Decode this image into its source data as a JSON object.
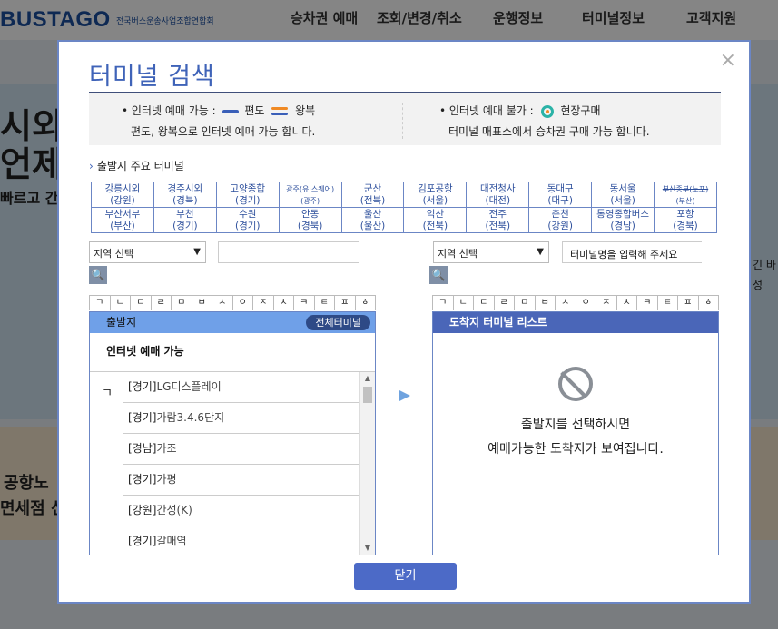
{
  "background": {
    "logo": "BUSTAGO",
    "logo_sub": "전국버스운송사업조합연합회",
    "nav": [
      "승차권 예매",
      "조회/변경/취소",
      "운행정보",
      "터미널정보",
      "고객지원"
    ],
    "banner_left": [
      "시외",
      "언제",
      "빠르고 간"
    ],
    "banner_right": [
      "긴 바",
      "성"
    ],
    "promo_left": [
      "공항노",
      "면세점 선"
    ]
  },
  "modal": {
    "title": "터미널 검색",
    "close_icon": "×",
    "info": {
      "possible_label": "• 인터넷 예매 가능 :",
      "oneway": "편도",
      "roundtrip": "왕복",
      "possible_desc": "편도, 왕복으로 인터넷 예매 가능 합니다.",
      "impossible_label": "• 인터넷 예매 불가 :",
      "onsite": "현장구매",
      "impossible_desc": "터미널 매표소에서 승차권 구매 가능 합니다."
    },
    "major_title": "출발지 주요 터미널",
    "major_terminals": [
      [
        {
          "name": "강릉시외",
          "region": "(강원)"
        },
        {
          "name": "경주시외",
          "region": "(경북)"
        },
        {
          "name": "고양종합",
          "region": "(경기)"
        },
        {
          "name": "광주(유·스퀘어)",
          "region": "(광주)"
        },
        {
          "name": "군산",
          "region": "(전북)"
        },
        {
          "name": "김포공항",
          "region": "(서울)"
        },
        {
          "name": "대전청사",
          "region": "(대전)"
        },
        {
          "name": "동대구",
          "region": "(대구)"
        },
        {
          "name": "동서울",
          "region": "(서울)"
        },
        {
          "name": "부산종부(노포)",
          "region": "(부산)"
        }
      ],
      [
        {
          "name": "부산서부",
          "region": "(부산)"
        },
        {
          "name": "부천",
          "region": "(경기)"
        },
        {
          "name": "수원",
          "region": "(경기)"
        },
        {
          "name": "안동",
          "region": "(경북)"
        },
        {
          "name": "울산",
          "region": "(울산)"
        },
        {
          "name": "익산",
          "region": "(전북)"
        },
        {
          "name": "전주",
          "region": "(전북)"
        },
        {
          "name": "춘천",
          "region": "(강원)"
        },
        {
          "name": "통영종합버스",
          "region": "(경남)"
        },
        {
          "name": "포항",
          "region": "(경북)"
        }
      ]
    ],
    "departure": {
      "region_select": "지역 선택",
      "search_value": "",
      "initials": [
        "ㄱ",
        "ㄴ",
        "ㄷ",
        "ㄹ",
        "ㅁ",
        "ㅂ",
        "ㅅ",
        "ㅇ",
        "ㅈ",
        "ㅊ",
        "ㅋ",
        "ㅌ",
        "ㅍ",
        "ㅎ"
      ],
      "header": "출발지",
      "all_button": "전체터미널",
      "sub_header": "인터넷 예매 가능",
      "current_initial": "ㄱ",
      "terminals": [
        {
          "region": "[경기]",
          "name": "LG디스플레이"
        },
        {
          "region": "[경기]",
          "name": "가람3.4.6단지"
        },
        {
          "region": "[경남]",
          "name": "가조"
        },
        {
          "region": "[경기]",
          "name": "가평"
        },
        {
          "region": "[강원]",
          "name": "간성(K)"
        },
        {
          "region": "[경기]",
          "name": "갈매역"
        }
      ]
    },
    "destination": {
      "region_select": "지역 선택",
      "search_placeholder": "터미널명을 입력해 주세요",
      "initials": [
        "ㄱ",
        "ㄴ",
        "ㄷ",
        "ㄹ",
        "ㅁ",
        "ㅂ",
        "ㅅ",
        "ㅇ",
        "ㅈ",
        "ㅊ",
        "ㅋ",
        "ㅌ",
        "ㅍ",
        "ㅎ"
      ],
      "header": "도착지 터미널 리스트",
      "message_line1": "출발지를 선택하시면",
      "message_line2": "예매가능한 도착지가 보여집니다."
    },
    "close_button": "닫기"
  }
}
